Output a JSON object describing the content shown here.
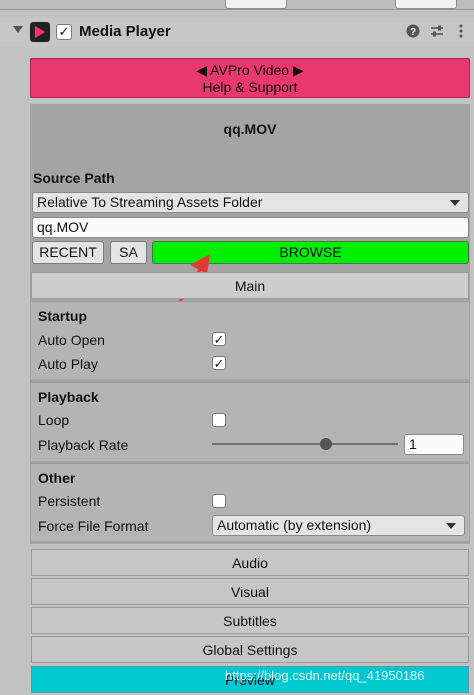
{
  "header": {
    "title": "Media Player",
    "enabled_checkmark": "✓",
    "icons": [
      "help-icon",
      "preset-icon",
      "more-icon"
    ]
  },
  "help_button": {
    "line1": "◀ AVPro Video ▶",
    "line2": "Help & Support"
  },
  "file": {
    "name": "qq.MOV"
  },
  "source": {
    "label": "Source Path",
    "path_mode": "Relative To Streaming Assets Folder",
    "path_value": "qq.MOV",
    "buttons": {
      "recent": "RECENT",
      "sa": "SA",
      "browse": "BROWSE"
    },
    "browse_color": "#00ee00"
  },
  "main_tab": "Main",
  "startup": {
    "title": "Startup",
    "auto_open_label": "Auto Open",
    "auto_open_mark": "✓",
    "auto_play_label": "Auto Play",
    "auto_play_mark": "✓"
  },
  "playback": {
    "title": "Playback",
    "loop_label": "Loop",
    "loop_mark": "",
    "rate_label": "Playback Rate",
    "rate_value": "1"
  },
  "other": {
    "title": "Other",
    "persistent_label": "Persistent",
    "persistent_mark": "",
    "format_label": "Force File Format",
    "format_value": "Automatic (by extension)"
  },
  "sections": {
    "audio": "Audio",
    "visual": "Visual",
    "subtitles": "Subtitles",
    "global": "Global Settings",
    "preview": "Preview"
  },
  "watermark": "https://blog.csdn.net/qq_41950186",
  "colors": {
    "help_bg": "#e9386f",
    "preview_bg": "#00c8d0",
    "arrow": "#e53935"
  }
}
